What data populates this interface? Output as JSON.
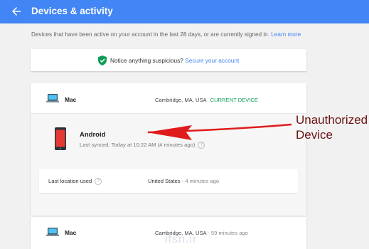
{
  "header": {
    "title": "Devices & activity",
    "back_icon": "arrow-left-icon",
    "color": "#4285f4"
  },
  "intro": {
    "text": "Devices that have been active on your account in the last 28 days, or are currently signed in.",
    "link": "Learn more"
  },
  "notice": {
    "icon": "shield-check-icon",
    "text": "Notice anything suspicious?",
    "link": "Secure your account"
  },
  "devices": [
    {
      "name": "Mac",
      "location": "Cambridge, MA, USA",
      "status": "CURRENT DEVICE",
      "icon": "laptop-icon"
    },
    {
      "name": "Android",
      "synced": "Last synced: Today at 10:22 AM (4 minutes ago)",
      "icon": "phone-icon",
      "last_location_label": "Last location used",
      "last_location_value": "United States",
      "last_location_time": "- 4 minutes ago"
    },
    {
      "name": "Mac",
      "location": "Cambridge, MA, USA",
      "time": "- 59 minutes ago",
      "icon": "laptop-icon"
    }
  ],
  "annotation": {
    "line1": "Unauthorized",
    "line2": "Device",
    "color": "#6a1212",
    "arrow_color": "#e01b1b"
  },
  "watermark": "ifsn.ir"
}
